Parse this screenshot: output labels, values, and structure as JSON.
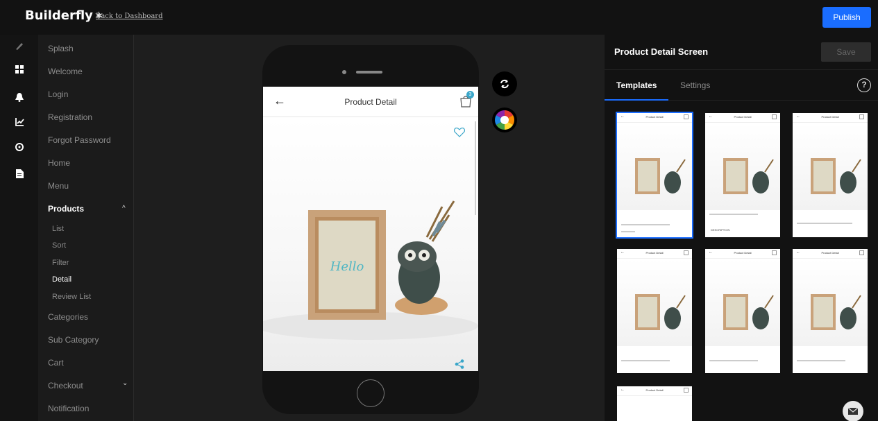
{
  "topbar": {
    "logo": "Builderfly",
    "back_link": "Back to Dashboard",
    "publish_label": "Publish"
  },
  "rail_icons": [
    "brush-icon",
    "dashboard-icon",
    "bell-icon",
    "chart-icon",
    "settings-icon",
    "document-icon"
  ],
  "nav": {
    "items": [
      {
        "label": "Splash"
      },
      {
        "label": "Welcome"
      },
      {
        "label": "Login"
      },
      {
        "label": "Registration"
      },
      {
        "label": "Forgot Password"
      },
      {
        "label": "Home"
      },
      {
        "label": "Menu"
      },
      {
        "label": "Products"
      },
      {
        "label": "Categories"
      },
      {
        "label": "Sub Category"
      },
      {
        "label": "Cart"
      },
      {
        "label": "Checkout"
      },
      {
        "label": "Notification"
      }
    ],
    "products_sub": [
      "List",
      "Sort",
      "Filter",
      "Detail",
      "Review List"
    ],
    "active_item": "Products",
    "active_sub": "Detail"
  },
  "preview": {
    "screen_title": "Product Detail",
    "cart_count": "3",
    "frame_text": "Hello"
  },
  "panel": {
    "title": "Product Detail Screen",
    "save_label": "Save",
    "tabs": [
      "Templates",
      "Settings"
    ],
    "active_tab": "Templates",
    "help_label": "?"
  },
  "templates": [
    {
      "title": "Product Detail",
      "label": ""
    },
    {
      "title": "Product Detail",
      "label": "DESCRIPTION"
    },
    {
      "title": "Product Detail",
      "label": ""
    },
    {
      "title": "Product Detail",
      "label": ""
    },
    {
      "title": "Product Detail",
      "label": ""
    },
    {
      "title": "Product Detail",
      "label": ""
    },
    {
      "title": "Product Detail",
      "label": ""
    }
  ],
  "colors": {
    "accent": "#1a6dff",
    "background": "#1e1e1e",
    "panel": "#121212"
  }
}
